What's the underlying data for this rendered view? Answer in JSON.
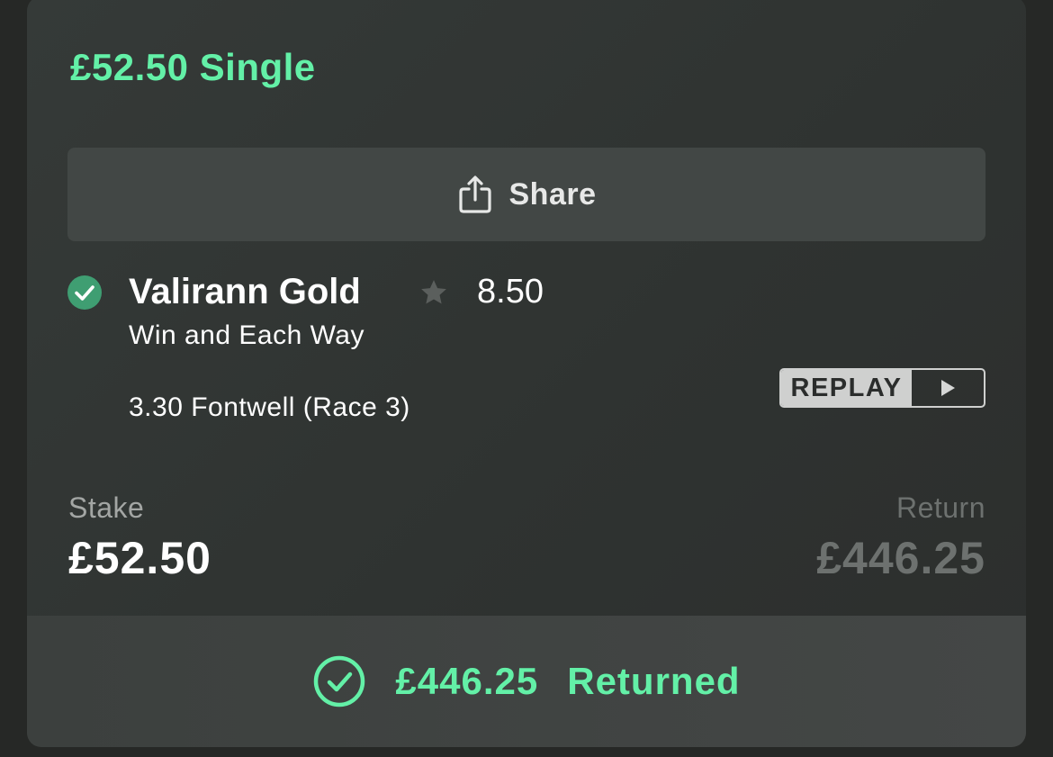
{
  "bet": {
    "title": "£52.50 Single"
  },
  "share": {
    "label": "Share",
    "icon": "share-icon"
  },
  "selection": {
    "status_icon": "check-circle-icon",
    "horse": "Valirann Gold",
    "favourite_icon": "star-icon",
    "odds": "8.50",
    "market": "Win and Each Way",
    "race": "3.30 Fontwell (Race 3)",
    "replay_label": "REPLAY",
    "replay_icon": "play-icon"
  },
  "stake": {
    "label": "Stake",
    "value": "£52.50"
  },
  "return": {
    "label": "Return",
    "value": "£446.25"
  },
  "result": {
    "icon": "check-circle-outline-icon",
    "amount": "£446.25",
    "label": "Returned"
  },
  "colors": {
    "accent": "#63f0a7",
    "background": "#262826",
    "card": "#323634",
    "muted": "#6d716f",
    "win_check": "#3f9e72"
  }
}
